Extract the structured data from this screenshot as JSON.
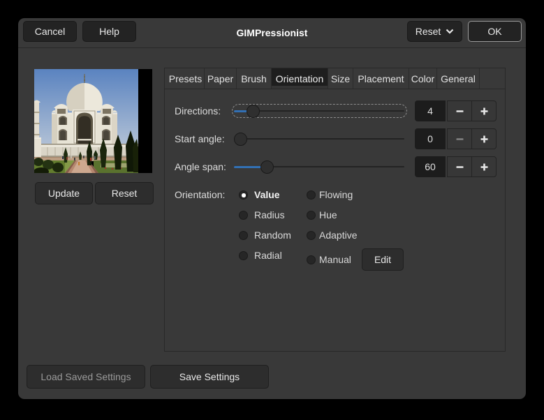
{
  "window": {
    "title": "GIMPressionist"
  },
  "header": {
    "cancel": "Cancel",
    "help": "Help",
    "reset": "Reset",
    "ok": "OK"
  },
  "preview": {
    "update": "Update",
    "reset": "Reset",
    "image": "taj-mahal-photo"
  },
  "tabs": [
    "Presets",
    "Paper",
    "Brush",
    "Orientation",
    "Size",
    "Placement",
    "Color",
    "General"
  ],
  "active_tab": "Orientation",
  "sliders": [
    {
      "label": "Directions:",
      "value": "4",
      "handle_pct": 11.5,
      "focused": true,
      "minus_disabled": false
    },
    {
      "label": "Start angle:",
      "value": "0",
      "handle_pct": 3.7,
      "focused": false,
      "minus_disabled": true
    },
    {
      "label": "Angle span:",
      "value": "60",
      "handle_pct": 19.7,
      "focused": false,
      "minus_disabled": false
    }
  ],
  "orientation": {
    "label": "Orientation:",
    "selected": "Value",
    "options": [
      {
        "label": "Value"
      },
      {
        "label": "Flowing"
      },
      {
        "label": "Radius"
      },
      {
        "label": "Hue"
      },
      {
        "label": "Random"
      },
      {
        "label": "Adaptive"
      },
      {
        "label": "Radial"
      },
      {
        "label": "Manual"
      }
    ],
    "edit": "Edit"
  },
  "footer": {
    "load": "Load Saved Settings",
    "save": "Save Settings"
  }
}
